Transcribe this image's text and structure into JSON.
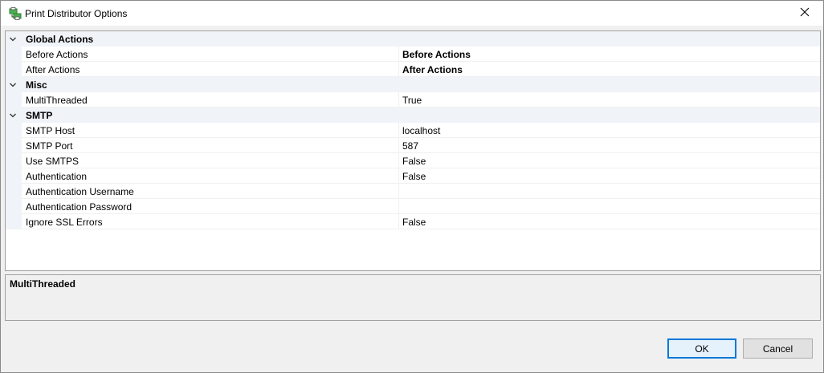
{
  "window": {
    "title": "Print Distributor Options",
    "app_icon": "print-distributor-icon",
    "close_icon": "close-icon"
  },
  "grid": {
    "categories": [
      {
        "label": "Global Actions",
        "properties": [
          {
            "name": "Before Actions",
            "value": "Before Actions",
            "bold": true
          },
          {
            "name": "After Actions",
            "value": "After Actions",
            "bold": true
          }
        ]
      },
      {
        "label": "Misc",
        "properties": [
          {
            "name": "MultiThreaded",
            "value": "True",
            "bold": false
          }
        ]
      },
      {
        "label": "SMTP",
        "properties": [
          {
            "name": "SMTP Host",
            "value": "localhost",
            "bold": false
          },
          {
            "name": "SMTP Port",
            "value": "587",
            "bold": false
          },
          {
            "name": "Use SMTPS",
            "value": "False",
            "bold": false
          },
          {
            "name": "Authentication",
            "value": "False",
            "bold": false
          },
          {
            "name": "Authentication Username",
            "value": "",
            "bold": false
          },
          {
            "name": "Authentication Password",
            "value": "",
            "bold": false
          },
          {
            "name": "Ignore SSL Errors",
            "value": "False",
            "bold": false
          }
        ]
      }
    ]
  },
  "description": {
    "title": "MultiThreaded"
  },
  "buttons": {
    "ok": "OK",
    "cancel": "Cancel"
  },
  "colors": {
    "accent": "#0078d7",
    "category_background": "#f0f3f8"
  }
}
